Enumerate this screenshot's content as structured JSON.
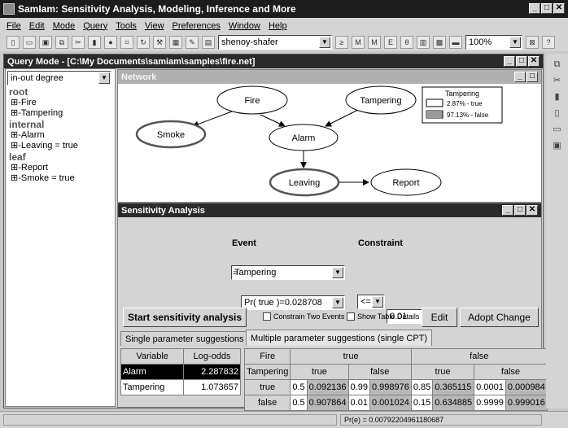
{
  "app": {
    "title": "SamIam: Sensitivity Analysis, Modeling, Inference and More"
  },
  "menu": [
    "File",
    "Edit",
    "Mode",
    "Query",
    "Tools",
    "View",
    "Preferences",
    "Window",
    "Help"
  ],
  "toolbar": {
    "algorithm": "shenoy-shafer",
    "zoom": "100%"
  },
  "query_window": {
    "title": "Query Mode - [C:\\My Documents\\samiam\\samples\\fire.net]"
  },
  "tree": {
    "sort_mode": "in-out degree",
    "groups": [
      {
        "label": "root",
        "items": [
          "Fire",
          "Tampering"
        ]
      },
      {
        "label": "internal",
        "items": [
          "Alarm",
          "Leaving = true"
        ]
      },
      {
        "label": "leaf",
        "items": [
          "Report",
          "Smoke = true"
        ]
      }
    ]
  },
  "network": {
    "title": "Network",
    "nodes": [
      "Fire",
      "Tampering",
      "Smoke",
      "Alarm",
      "Leaving",
      "Report"
    ],
    "monitor": {
      "title": "Tampering",
      "rows": [
        {
          "value": "2.87% - true",
          "p": 0.0287
        },
        {
          "value": "97.13% - false",
          "p": 0.9713
        }
      ]
    }
  },
  "sensitivity": {
    "title": "Sensitivity Analysis",
    "event_label": "Event",
    "event_value": "Tampering",
    "event_prob": "Pr( true )=0.028708",
    "equals": "=",
    "constraint_label": "Constraint",
    "constraint_op": "<=",
    "constraint_value": "0.01",
    "start_button": "Start sensitivity analysis",
    "chk_two_events": "Constrain Two Events",
    "chk_table_details": "Show Table Details",
    "edit_button": "Edit",
    "adopt_button": "Adopt Change",
    "tab_single": "Single parameter suggestions",
    "tab_multiple": "Multiple parameter suggestions (single CPT)",
    "single_table": {
      "headers": [
        "Variable",
        "Log-odds"
      ],
      "rows": [
        [
          "Alarm",
          "2.287832"
        ],
        [
          "Tampering",
          "1.073657"
        ]
      ]
    },
    "multi_table": {
      "corner_top": "Fire",
      "corner_bottom": "Tampering",
      "fire_states": [
        "true",
        "false"
      ],
      "tamper_states": [
        "true",
        "false",
        "true",
        "false"
      ],
      "rows": [
        {
          "label": "true",
          "cells": [
            [
              "0.5",
              "0.092136"
            ],
            [
              "0.99",
              "0.998976"
            ],
            [
              "0.85",
              "0.365115"
            ],
            [
              "0.0001",
              "0.000984"
            ]
          ]
        },
        {
          "label": "false",
          "cells": [
            [
              "0.5",
              "0.907864"
            ],
            [
              "0.01",
              "0.001024"
            ],
            [
              "0.15",
              "0.634885"
            ],
            [
              "0.9999",
              "0.999016"
            ]
          ]
        }
      ]
    }
  },
  "status": {
    "text": "Pr(e) = 0.00792204961180687"
  }
}
